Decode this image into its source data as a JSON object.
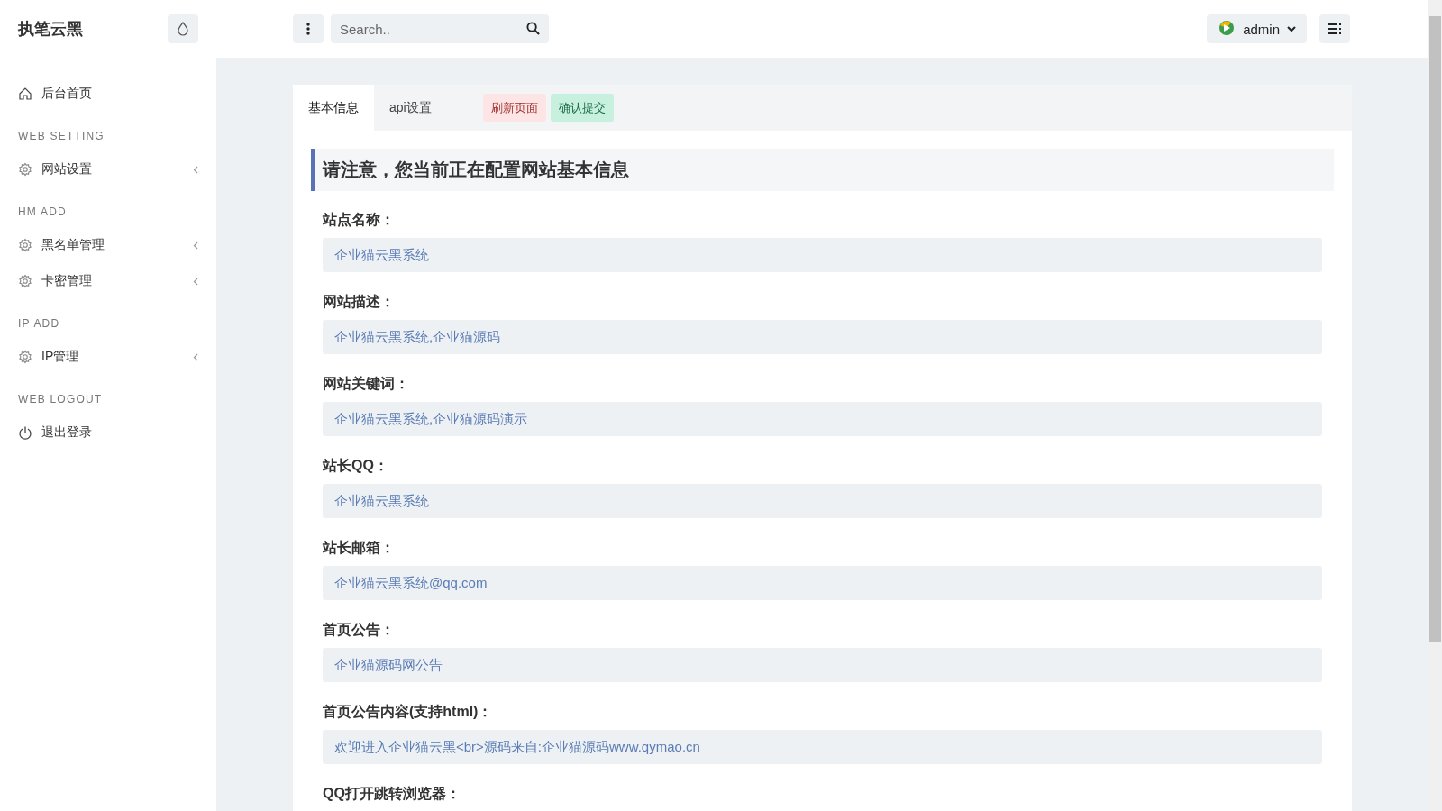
{
  "brand": "执笔云黑",
  "search": {
    "placeholder": "Search.."
  },
  "user": {
    "name": "admin"
  },
  "sidebar": {
    "items": [
      {
        "kind": "home",
        "label": "后台首页"
      },
      {
        "kind": "heading",
        "label": "WEB SETTING"
      },
      {
        "kind": "menu",
        "label": "网站设置"
      },
      {
        "kind": "heading",
        "label": "HM ADD"
      },
      {
        "kind": "menu",
        "label": "黑名单管理"
      },
      {
        "kind": "menu",
        "label": "卡密管理"
      },
      {
        "kind": "heading",
        "label": "IP ADD"
      },
      {
        "kind": "menu",
        "label": "IP管理"
      },
      {
        "kind": "heading",
        "label": "WEB LOGOUT"
      },
      {
        "kind": "logout",
        "label": "退出登录"
      }
    ]
  },
  "tabs": [
    {
      "label": "基本信息",
      "selected": true
    },
    {
      "label": "api设置",
      "selected": false
    }
  ],
  "actions": [
    {
      "label": "刷新页面",
      "kind": "danger"
    },
    {
      "label": "确认提交",
      "kind": "success"
    }
  ],
  "notice": "请注意，您当前正在配置网站基本信息",
  "fields": [
    {
      "label": "站点名称：",
      "value": "企业猫云黑系统"
    },
    {
      "label": "网站描述：",
      "value": "企业猫云黑系统,企业猫源码"
    },
    {
      "label": "网站关键词：",
      "value": "企业猫云黑系统,企业猫源码演示"
    },
    {
      "label": "站长QQ：",
      "value": "企业猫云黑系统"
    },
    {
      "label": "站长邮箱：",
      "value": "企业猫云黑系统@qq.com"
    },
    {
      "label": "首页公告：",
      "value": "企业猫源码网公告"
    },
    {
      "label": "首页公告内容(支持html)：",
      "value": "欢迎进入企业猫云黑<br>源码来自:企业猫源码www.qymao.cn"
    },
    {
      "label": "QQ打开跳转浏览器："
    }
  ]
}
